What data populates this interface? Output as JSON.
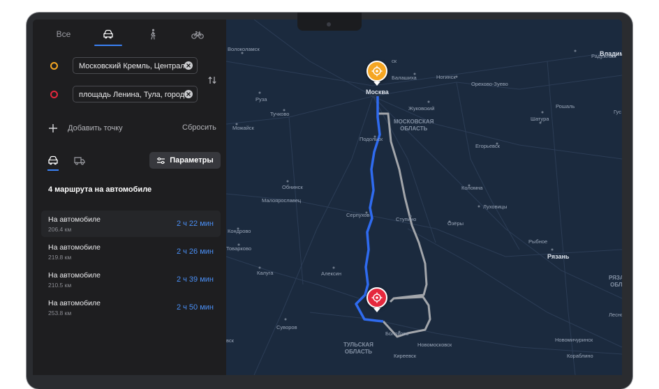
{
  "transport_tabs": [
    {
      "label": "Все",
      "icon": "all-text",
      "active": false
    },
    {
      "label": "",
      "icon": "car-icon",
      "active": true
    },
    {
      "label": "",
      "icon": "pedestrian-icon",
      "active": false
    },
    {
      "label": "",
      "icon": "bicycle-icon",
      "active": false
    }
  ],
  "route_points": {
    "from": {
      "value": "Московский Кремль, Централь",
      "dot_color": "#f5a623"
    },
    "to": {
      "value": "площадь Ленина, Тула, городск",
      "dot_color": "#e5283d"
    }
  },
  "actions": {
    "add_point": "Добавить точку",
    "reset": "Сбросить",
    "parameters": "Параметры"
  },
  "routes_title": "4 маршрута на автомобиле",
  "routes": [
    {
      "name": "На автомобиле",
      "distance": "206.4 км",
      "time": "2 ч 22 мин"
    },
    {
      "name": "На автомобиле",
      "distance": "219.8 км",
      "time": "2 ч 26 мин"
    },
    {
      "name": "На автомобиле",
      "distance": "210.5 км",
      "time": "2 ч 39 мин"
    },
    {
      "name": "На автомобиле",
      "distance": "253.8 км",
      "time": "2 ч 50 мин"
    }
  ],
  "map": {
    "labels": {
      "volokolamsk": "Волоколамск",
      "vladimir": "Владими",
      "raduzhny": "Радужный",
      "balashikha": "Балашиха",
      "noginsk": "Ногинск",
      "orekhovo": "Орехово-Зуево",
      "moskva": "Москва",
      "ruza": "Руза",
      "tuchkovo": "Тучково",
      "zhukovsky": "Жуковский",
      "roshal": "Рошаль",
      "gus": "Гус",
      "mozhaysk": "Можайск",
      "shatura": "Шатура",
      "region_mo": "МОСКОВСКАЯ\nОБЛАСТЬ",
      "podolsk": "Подольск",
      "egoryevsk": "Егорьевск",
      "obninsk": "Обнинск",
      "kolomna": "Коломна",
      "maloyaroslavets": "Малоярославец",
      "lukhovitsy": "Луховицы",
      "serpukhov": "Серпухов",
      "stupino": "Ступино",
      "ozery": "Озёры",
      "kondrovo": "Кондрово",
      "tovarkovo": "Товарково",
      "rybnoe": "Рыбное",
      "ryazan": "Рязань",
      "kaluga": "Калуга",
      "aleksin": "Алексин",
      "ryazan_region": "РЯЗА\nОБЛ",
      "suvorov": "Суворов",
      "bolokhovo": "Болохово",
      "novomoskovsk": "Новомосковск",
      "lesno": "Лесно",
      "region_tula": "ТУЛЬСКАЯ\nОБЛАСТЬ",
      "novomichurinsk": "Новомичуринск",
      "kireevsk": "Киреевск",
      "korablino": "Кораблино",
      "vsk": "вск",
      "slk": "ск"
    },
    "colors": {
      "background": "#1b2a3e",
      "primary_route": "#2f6bf0",
      "alternative_route": "#a3a6ab",
      "start_pin": "#f5a623",
      "end_pin": "#e5283d"
    }
  }
}
